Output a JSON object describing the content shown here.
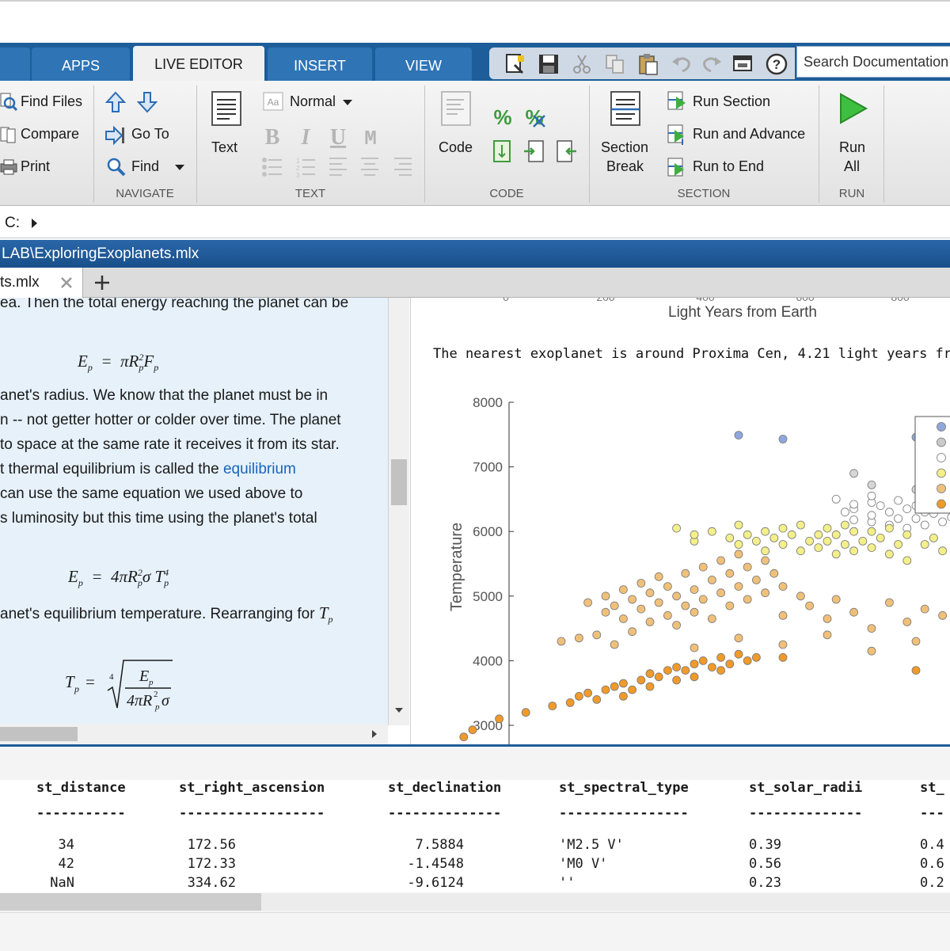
{
  "tabs": [
    {
      "label": "APPS",
      "active": false
    },
    {
      "label": "LIVE EDITOR",
      "active": true
    },
    {
      "label": "INSERT",
      "active": false
    },
    {
      "label": "VIEW",
      "active": false
    }
  ],
  "search": {
    "placeholder": "Search Documentation"
  },
  "ribbon": {
    "file": {
      "find_files": "Find Files",
      "compare": "Compare",
      "print": "Print"
    },
    "navigate": {
      "go_to": "Go To",
      "find": "Find",
      "group_label": "NAVIGATE"
    },
    "text": {
      "text_button": "Text",
      "style": "Normal",
      "group_label": "TEXT"
    },
    "code": {
      "code_button": "Code",
      "group_label": "CODE"
    },
    "section": {
      "break_line1": "Section",
      "break_line2": "Break",
      "run_section": "Run Section",
      "run_and_advance": "Run and Advance",
      "run_to_end": "Run to End",
      "group_label": "SECTION"
    },
    "run": {
      "run_all_line1": "Run",
      "run_all_line2": "All",
      "group_label": "RUN"
    }
  },
  "address": {
    "path": "C:"
  },
  "title_bar": {
    "path": "LAB\\ExploringExoplanets.mlx"
  },
  "doc_tab": {
    "name": "ts.mlx"
  },
  "text_pane": {
    "lines": [
      "ea.  Then the total energy reaching the planet can be",
      "anet's radius.  We know that the planet must be in",
      "n -- not getter hotter or colder over time.  The planet",
      "to space at the same rate it receives it from its star.",
      "t thermal equilibrium is called the ",
      "can use the same equation we used above to",
      "s luminosity but this time using the planet's total",
      "anet's equilibrium temperature.  Rearranging for "
    ],
    "link": "equilibrium"
  },
  "output": {
    "prev_xlabel": "Light Years from Earth",
    "message": "The nearest exoplanet is around Proxima Cen, 4.21 light years fr"
  },
  "chart_data": {
    "type": "scatter",
    "title": "",
    "xlabel": "",
    "ylabel": "Temperature",
    "ylim": [
      2800,
      8200
    ],
    "xlim": [
      0,
      1000
    ],
    "yticks": [
      3000,
      4000,
      5000,
      6000,
      7000,
      8000
    ],
    "grid": false,
    "legend_placement": "top-right",
    "series_colors": [
      "#8fa7dd",
      "#c9c9c9",
      "#ffffff",
      "#f3ef8a",
      "#f0c07a",
      "#ef9a2a"
    ],
    "series": [
      {
        "color": "#8fa7dd",
        "points": [
          [
            25,
            7490
          ],
          [
            30,
            7430
          ],
          [
            45,
            7460
          ]
        ]
      },
      {
        "color": "#d6d6d6",
        "points": [
          [
            38,
            6900
          ],
          [
            40,
            6720
          ],
          [
            45,
            6650
          ],
          [
            52,
            6410
          ],
          [
            58,
            6350
          ]
        ]
      },
      {
        "color": "#ffffff",
        "points": [
          [
            36,
            6500
          ],
          [
            37,
            6300
          ],
          [
            38,
            6350
          ],
          [
            38,
            6180
          ],
          [
            38,
            6420
          ],
          [
            40,
            6450
          ],
          [
            40,
            6150
          ],
          [
            40,
            6250
          ],
          [
            40,
            6550
          ],
          [
            41,
            6400
          ],
          [
            42,
            6300
          ],
          [
            42,
            6100
          ],
          [
            43,
            6200
          ],
          [
            43,
            6480
          ],
          [
            44,
            6350
          ],
          [
            44,
            6050
          ],
          [
            45,
            6400
          ],
          [
            45,
            6200
          ],
          [
            46,
            6100
          ],
          [
            46,
            6300
          ],
          [
            47,
            6450
          ],
          [
            47,
            6280
          ],
          [
            48,
            6150
          ],
          [
            48,
            6360
          ],
          [
            49,
            6220
          ],
          [
            50,
            6300
          ],
          [
            50,
            6420
          ],
          [
            52,
            6250
          ],
          [
            52,
            6100
          ],
          [
            54,
            6350
          ],
          [
            56,
            6200
          ],
          [
            58,
            6300
          ],
          [
            60,
            6100
          ],
          [
            62,
            6150
          ]
        ]
      },
      {
        "color": "#f3ef8a",
        "points": [
          [
            18,
            6050
          ],
          [
            20,
            5850
          ],
          [
            20,
            5950
          ],
          [
            22,
            6000
          ],
          [
            24,
            5900
          ],
          [
            25,
            5800
          ],
          [
            25,
            6100
          ],
          [
            26,
            5950
          ],
          [
            27,
            5850
          ],
          [
            28,
            6000
          ],
          [
            28,
            5700
          ],
          [
            29,
            5900
          ],
          [
            30,
            6050
          ],
          [
            30,
            5800
          ],
          [
            31,
            5950
          ],
          [
            32,
            5700
          ],
          [
            32,
            6100
          ],
          [
            33,
            5850
          ],
          [
            34,
            5950
          ],
          [
            34,
            5750
          ],
          [
            35,
            6050
          ],
          [
            35,
            5850
          ],
          [
            36,
            5650
          ],
          [
            36,
            5950
          ],
          [
            37,
            6100
          ],
          [
            37,
            5800
          ],
          [
            38,
            5700
          ],
          [
            38,
            6000
          ],
          [
            39,
            5850
          ],
          [
            40,
            6000
          ],
          [
            40,
            5750
          ],
          [
            41,
            5900
          ],
          [
            42,
            5650
          ],
          [
            42,
            6050
          ],
          [
            43,
            5800
          ],
          [
            44,
            5950
          ],
          [
            44,
            5550
          ],
          [
            46,
            5800
          ],
          [
            47,
            5900
          ],
          [
            48,
            5700
          ],
          [
            50,
            5600
          ],
          [
            52,
            5800
          ],
          [
            55,
            5500
          ],
          [
            60,
            5350
          ],
          [
            65,
            5150
          ],
          [
            70,
            5100
          ],
          [
            78,
            5000
          ],
          [
            85,
            5050
          ],
          [
            92,
            5100
          ],
          [
            100,
            5000
          ],
          [
            108,
            5050
          ],
          [
            120,
            5100
          ],
          [
            132,
            5000
          ],
          [
            145,
            4980
          ],
          [
            153,
            4950
          ],
          [
            58,
            5700
          ]
        ]
      },
      {
        "color": "#f0c07a",
        "points": [
          [
            8,
            4900
          ],
          [
            10,
            5000
          ],
          [
            10,
            4750
          ],
          [
            11,
            4850
          ],
          [
            12,
            5100
          ],
          [
            12,
            4650
          ],
          [
            13,
            4950
          ],
          [
            14,
            5200
          ],
          [
            14,
            4800
          ],
          [
            15,
            5050
          ],
          [
            15,
            4600
          ],
          [
            16,
            4900
          ],
          [
            16,
            5300
          ],
          [
            17,
            4700
          ],
          [
            17,
            5150
          ],
          [
            18,
            5000
          ],
          [
            18,
            4550
          ],
          [
            19,
            4850
          ],
          [
            19,
            5350
          ],
          [
            20,
            5100
          ],
          [
            20,
            4750
          ],
          [
            21,
            5450
          ],
          [
            21,
            4950
          ],
          [
            22,
            5250
          ],
          [
            22,
            4650
          ],
          [
            23,
            5550
          ],
          [
            23,
            5050
          ],
          [
            24,
            4850
          ],
          [
            24,
            5350
          ],
          [
            25,
            5650
          ],
          [
            25,
            5150
          ],
          [
            26,
            4950
          ],
          [
            26,
            5450
          ],
          [
            27,
            5250
          ],
          [
            28,
            5050
          ],
          [
            28,
            5550
          ],
          [
            29,
            5350
          ],
          [
            30,
            5150
          ],
          [
            30,
            4700
          ],
          [
            32,
            5000
          ],
          [
            33,
            4850
          ],
          [
            35,
            4650
          ],
          [
            36,
            4950
          ],
          [
            38,
            4750
          ],
          [
            40,
            4500
          ],
          [
            42,
            4900
          ],
          [
            44,
            4600
          ],
          [
            46,
            4800
          ],
          [
            48,
            4700
          ],
          [
            50,
            4950
          ],
          [
            52,
            4650
          ],
          [
            55,
            4850
          ],
          [
            58,
            4450
          ],
          [
            60,
            4950
          ],
          [
            62,
            5000
          ],
          [
            64,
            4900
          ],
          [
            66,
            5050
          ],
          [
            68,
            4850
          ],
          [
            70,
            5000
          ],
          [
            72,
            4950
          ],
          [
            74,
            4400
          ],
          [
            76,
            4850
          ],
          [
            78,
            5000
          ],
          [
            80,
            4900
          ],
          [
            82,
            5000
          ],
          [
            84,
            4950
          ],
          [
            86,
            4900
          ],
          [
            88,
            5050
          ],
          [
            90,
            4900
          ],
          [
            95,
            4850
          ],
          [
            100,
            4950
          ],
          [
            105,
            4850
          ],
          [
            110,
            4900
          ],
          [
            115,
            4950
          ],
          [
            120,
            4850
          ],
          [
            125,
            4900
          ],
          [
            130,
            5000
          ],
          [
            135,
            4950
          ],
          [
            140,
            4920
          ],
          [
            5,
            4300
          ],
          [
            7,
            4350
          ],
          [
            9,
            4400
          ],
          [
            11,
            4250
          ],
          [
            13,
            4450
          ],
          [
            20,
            4200
          ],
          [
            25,
            4350
          ],
          [
            30,
            4250
          ],
          [
            35,
            4400
          ],
          [
            40,
            4150
          ],
          [
            45,
            4300
          ],
          [
            50,
            4200
          ],
          [
            55,
            4400
          ],
          [
            60,
            4300
          ],
          [
            65,
            4350
          ],
          [
            70,
            4450
          ],
          [
            75,
            4300
          ],
          [
            80,
            4350
          ]
        ]
      },
      {
        "color": "#ef9a2a",
        "points": [
          [
            -2,
            3100
          ],
          [
            1,
            3200
          ],
          [
            4,
            3300
          ],
          [
            6,
            3350
          ],
          [
            7,
            3450
          ],
          [
            8,
            3500
          ],
          [
            9,
            3400
          ],
          [
            10,
            3550
          ],
          [
            11,
            3600
          ],
          [
            12,
            3650
          ],
          [
            12,
            3450
          ],
          [
            13,
            3550
          ],
          [
            14,
            3700
          ],
          [
            15,
            3600
          ],
          [
            15,
            3800
          ],
          [
            16,
            3750
          ],
          [
            17,
            3850
          ],
          [
            18,
            3700
          ],
          [
            18,
            3900
          ],
          [
            19,
            3850
          ],
          [
            20,
            3950
          ],
          [
            20,
            3750
          ],
          [
            21,
            4000
          ],
          [
            22,
            3900
          ],
          [
            23,
            4050
          ],
          [
            24,
            3950
          ],
          [
            25,
            4100
          ],
          [
            26,
            4000
          ],
          [
            27,
            4050
          ],
          [
            23,
            3850
          ],
          [
            30,
            4050
          ],
          [
            45,
            3850
          ],
          [
            -5,
            2930
          ],
          [
            -6,
            2820
          ]
        ]
      }
    ]
  },
  "bottom_table": {
    "headers": [
      "st_distance",
      "st_right_ascension",
      "st_declination",
      "st_spectral_type",
      "st_solar_radii",
      "st_"
    ],
    "underlines": [
      "-----------",
      "------------------",
      "--------------",
      "----------------",
      "--------------",
      "---"
    ],
    "rows": [
      [
        "34",
        "172.56",
        "7.5884",
        "'M2.5 V'",
        "0.39",
        "0.4"
      ],
      [
        "42",
        "172.33",
        "-1.4548",
        "'M0 V'",
        "0.56",
        "0.6"
      ],
      [
        "NaN",
        "334.62",
        "-9.6124",
        "''",
        "0.23",
        "0.2"
      ]
    ]
  }
}
